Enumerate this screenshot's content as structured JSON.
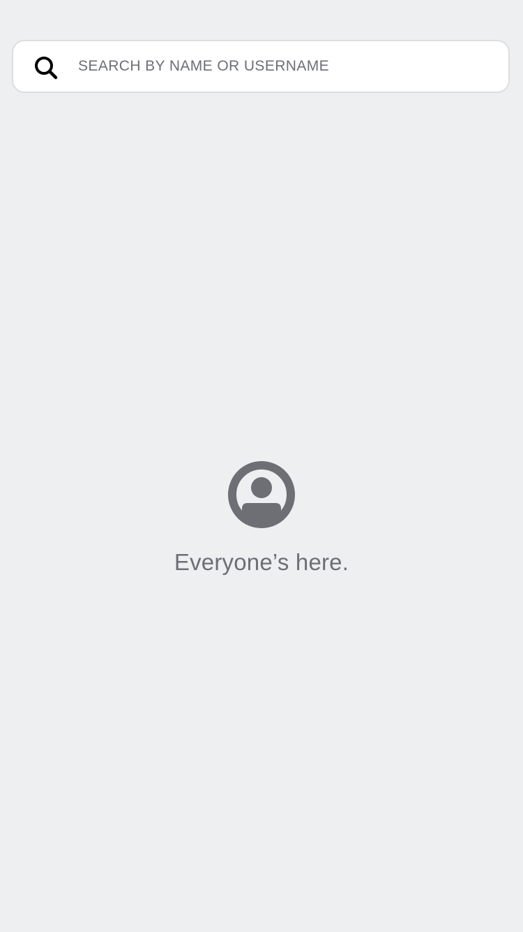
{
  "search": {
    "placeholder": "SEARCH BY NAME OR USERNAME",
    "value": "",
    "icon": "search-icon"
  },
  "empty_state": {
    "icon": "user-circle-icon",
    "message": "Everyone’s here."
  },
  "colors": {
    "background": "#eeeff1",
    "search_background": "#ffffff",
    "search_border": "#dcdde0",
    "muted_text": "#6d6f75",
    "icon_dark": "#000000",
    "avatar_gray": "#6d6f75"
  }
}
